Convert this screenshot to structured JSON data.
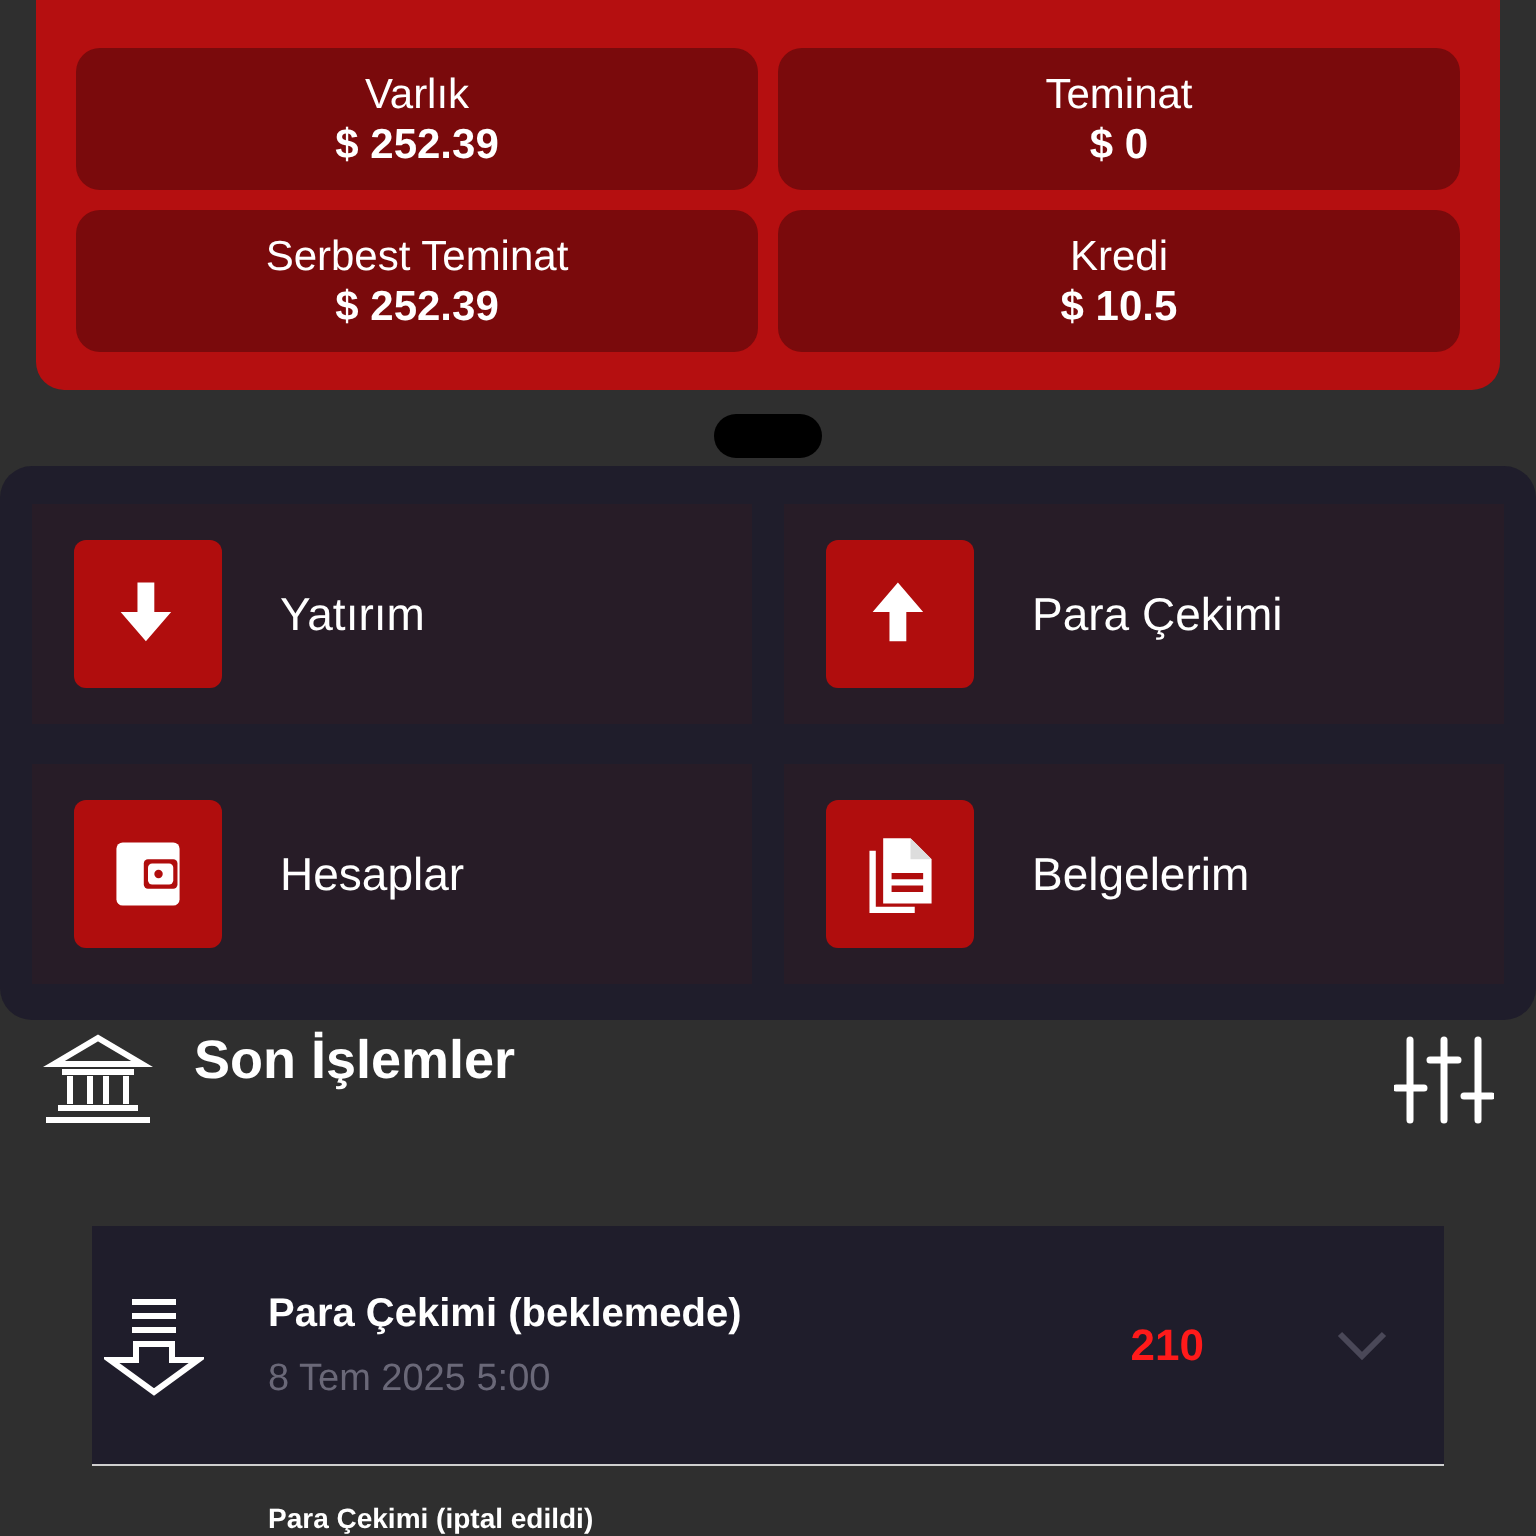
{
  "summary_cards": [
    {
      "label": "Varlık",
      "value": "$ 252.39"
    },
    {
      "label": "Teminat",
      "value": "$ 0"
    },
    {
      "label": "Serbest Teminat",
      "value": "$ 252.39"
    },
    {
      "label": "Kredi",
      "value": "$ 10.5"
    }
  ],
  "actions": [
    {
      "kind": "deposit",
      "label": "Yatırım"
    },
    {
      "kind": "withdraw",
      "label": "Para Çekimi"
    },
    {
      "kind": "wallet",
      "label": "Hesaplar"
    },
    {
      "kind": "documents",
      "label": "Belgelerim"
    }
  ],
  "transactions_heading": "Son İşlemler",
  "transactions": [
    {
      "title": "Para Çekimi (beklemede)",
      "date": "8 Tem 2025 5:00",
      "amount": "210"
    },
    {
      "title": "Para Çekimi (iptal edildi)"
    }
  ]
}
